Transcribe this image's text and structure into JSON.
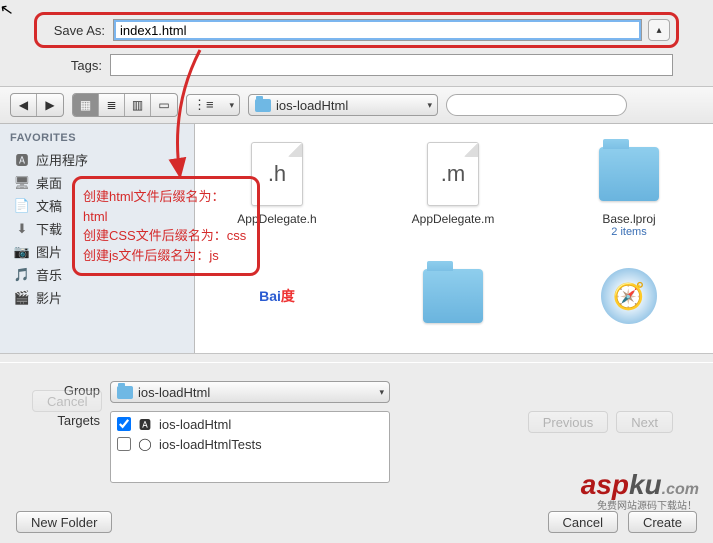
{
  "top": {
    "saveAsLabel": "Save As:",
    "saveAsValue": "index1.html",
    "tagsLabel": "Tags:",
    "tagsValue": ""
  },
  "toolbar": {
    "location": "ios-loadHtml",
    "searchPlaceholder": ""
  },
  "sidebar": {
    "header": "FAVORITES",
    "items": [
      {
        "icon": "🅰",
        "label": "应用程序"
      },
      {
        "icon": "🖥",
        "label": "桌面"
      },
      {
        "icon": "📄",
        "label": "文稿"
      },
      {
        "icon": "⬇",
        "label": "下载"
      },
      {
        "icon": "📷",
        "label": "图片"
      },
      {
        "icon": "🎵",
        "label": "音乐"
      },
      {
        "icon": "🎬",
        "label": "影片"
      }
    ]
  },
  "files": {
    "items": [
      {
        "kind": "doc",
        "ext": ".h",
        "name": "AppDelegate.h"
      },
      {
        "kind": "doc",
        "ext": ".m",
        "name": "AppDelegate.m"
      },
      {
        "kind": "folder",
        "name": "Base.lproj",
        "sub": "2 items"
      },
      {
        "kind": "baidu",
        "name": ""
      },
      {
        "kind": "folder",
        "name": ""
      },
      {
        "kind": "safari",
        "name": ""
      }
    ]
  },
  "annotation": {
    "line1": "创建html文件后缀名为：html",
    "line2": "创建CSS文件后缀名为：css",
    "line3": "创建js文件后缀名为：js"
  },
  "lower": {
    "groupLabel": "Group",
    "groupValue": "ios-loadHtml",
    "targetsLabel": "Targets",
    "targets": [
      {
        "checked": true,
        "icon": "🅰",
        "name": "ios-loadHtml"
      },
      {
        "checked": false,
        "icon": "◯",
        "name": "ios-loadHtmlTests"
      }
    ]
  },
  "buttons": {
    "newFolder": "New Folder",
    "cancel": "Cancel",
    "create": "Create",
    "previous": "Previous",
    "next": "Next"
  },
  "watermark": {
    "text1": "asp",
    "text2": "ku",
    "suffix": ".com",
    "sub": "免费网站源码下载站！"
  }
}
